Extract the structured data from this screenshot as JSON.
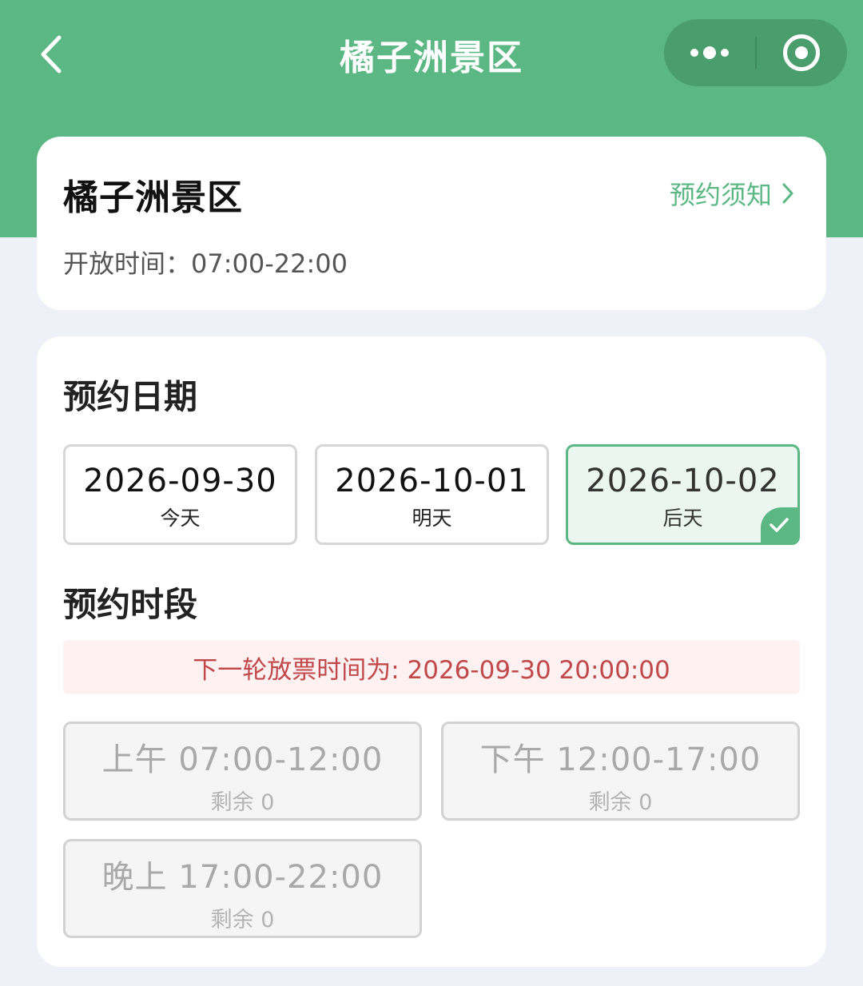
{
  "nav": {
    "title": "橘子洲景区",
    "back_icon": "chevron-left-icon",
    "more_icon": "more-dots-icon",
    "close_icon": "target-circle-icon"
  },
  "info": {
    "title": "橘子洲景区",
    "notice_link": "预约须知",
    "hours": "开放时间：07:00-22:00"
  },
  "booking": {
    "date_title": "预约日期",
    "dates": [
      {
        "date": "2026-10-02",
        "label": "后天",
        "selected": true
      },
      {
        "date": "2026-09-30",
        "label": "今天",
        "selected": false
      },
      {
        "date": "2026-10-01",
        "label": "明天",
        "selected": false
      }
    ],
    "slot_title": "预约时段",
    "release_notice": "下一轮放票时间为: 2026-09-30 20:00:00",
    "slots": [
      {
        "time": "上午 07:00-12:00",
        "remaining": "剩余 0"
      },
      {
        "time": "下午 12:00-17:00",
        "remaining": "剩余 0"
      },
      {
        "time": "晚上 17:00-22:00",
        "remaining": "剩余 0"
      }
    ]
  },
  "colors": {
    "brand_green": "#5bb884",
    "notice_red": "#c0474a",
    "notice_bg": "#fdf1f1",
    "page_bg": "#eef2f8"
  }
}
